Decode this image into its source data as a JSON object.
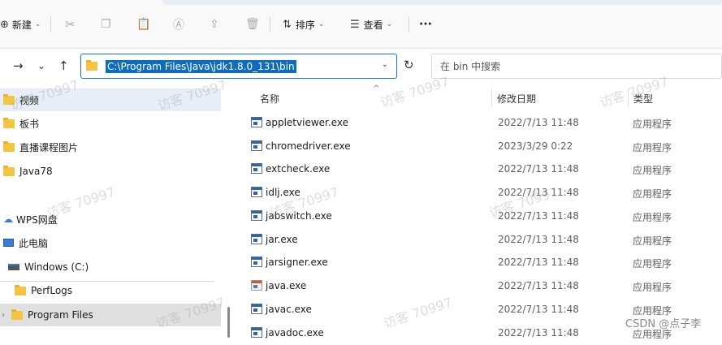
{
  "toolbar": {
    "new_label": "新建",
    "sort_label": "排序",
    "view_label": "查看",
    "more_label": "···"
  },
  "nav": {
    "address_path": "C:\\Program Files\\Java\\jdk1.8.0_131\\bin",
    "search_placeholder": "在 bin 中搜索"
  },
  "sidebar": {
    "items": [
      {
        "label": "视频"
      },
      {
        "label": "板书"
      },
      {
        "label": "直播课程图片"
      },
      {
        "label": "Java78"
      },
      {
        "label": "WPS网盘"
      },
      {
        "label": "此电脑"
      },
      {
        "label": "Windows (C:)"
      },
      {
        "label": "PerfLogs"
      },
      {
        "label": "Program Files"
      }
    ]
  },
  "columns": {
    "name": "名称",
    "date": "修改日期",
    "type": "类型"
  },
  "files": [
    {
      "name": "appletviewer.exe",
      "date": "2022/7/13 11:48",
      "type": "应用程序"
    },
    {
      "name": "chromedriver.exe",
      "date": "2023/3/29 0:22",
      "type": "应用程序"
    },
    {
      "name": "extcheck.exe",
      "date": "2022/7/13 11:48",
      "type": "应用程序"
    },
    {
      "name": "idlj.exe",
      "date": "2022/7/13 11:48",
      "type": "应用程序"
    },
    {
      "name": "jabswitch.exe",
      "date": "2022/7/13 11:48",
      "type": "应用程序"
    },
    {
      "name": "jar.exe",
      "date": "2022/7/13 11:48",
      "type": "应用程序"
    },
    {
      "name": "jarsigner.exe",
      "date": "2022/7/13 11:48",
      "type": "应用程序"
    },
    {
      "name": "java.exe",
      "date": "2022/7/13 11:48",
      "type": "应用程序"
    },
    {
      "name": "javac.exe",
      "date": "2022/7/13 11:48",
      "type": "应用程序"
    },
    {
      "name": "javadoc.exe",
      "date": "2022/7/13 11:48",
      "type": "应用程序"
    }
  ],
  "watermark": "访客 70997",
  "credit": "CSDN @点子李",
  "colors": {
    "accent": "#0f6cbd",
    "sidebar_selected": "#e8eef7",
    "folder": "#f4c542"
  }
}
